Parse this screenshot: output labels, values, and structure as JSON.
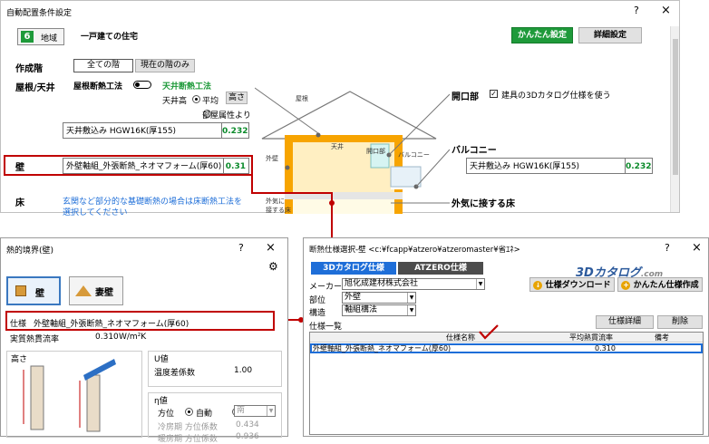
{
  "main": {
    "title": "自動配置条件設定",
    "help": "?",
    "close": "×",
    "region_number": "6",
    "region_label": "地域",
    "house_type": "一戸建ての住宅",
    "easy_button": "かんたん設定",
    "detail_button": "詳細設定",
    "floor_label": "作成階",
    "all_floors": "全ての階",
    "current_floor": "現在の階のみ",
    "roof_ceiling": "屋根/天井",
    "roof_insulation": "屋根断熱工法",
    "ceiling_insulation": "天井断熱工法",
    "ceiling_height": "天井高",
    "average": "平均",
    "height_btn": "高さ",
    "room_attr": "部屋属性より",
    "ceiling_spec": "天井敷込み HGW16K(厚155)",
    "ceiling_value": "0.232",
    "wall_label": "壁",
    "wall_spec": "外壁軸組_外張断熱_ネオマフォーム(厚60)",
    "wall_value": "0.31",
    "floor_section": "床",
    "floor_note": "玄関など部分的な基礎断熱の場合は床断熱工法を",
    "floor_note2": "選択してください",
    "opening": "開口部",
    "catalog_check": "建具の3Dカタログ仕様を使う",
    "balcony": "バルコニー",
    "balcony_spec": "天井敷込み HGW16K(厚155)",
    "balcony_value": "0.232",
    "outside_floor": "外気に接する床",
    "diagram": {
      "roof": "屋根",
      "ceiling": "天井",
      "opening": "開口部",
      "outer_wall": "外壁",
      "balcony": "バルコニー",
      "outside_a": "外気に",
      "outside_b": "接する床"
    }
  },
  "thermal": {
    "title": "熱的境界(壁)",
    "help": "?",
    "close": "×",
    "wall_tab": "壁",
    "gable_tab": "妻壁",
    "spec_label": "仕様",
    "spec_value": "外壁軸組_外張断熱_ネオマフォーム(厚60)",
    "heat_rate_label": "実質熱貫流率",
    "heat_rate_value": "0.310",
    "heat_rate_unit": "W/m²K",
    "height_label": "高さ",
    "u_value": "U値",
    "temp_coef": "温度差係数",
    "temp_coef_value": "1.00",
    "eta_value": "η値",
    "direction": "方位",
    "auto": "自動",
    "south": "南",
    "cooling": "冷房期 方位係数",
    "cooling_value": "0.434",
    "heating": "暖房期 方位係数",
    "heating_value": "0.936"
  },
  "spec": {
    "title": "断熱仕様選択-壁 <c:¥fcapp¥atzero¥atzeromaster¥省ｴﾈ>",
    "help": "?",
    "close": "×",
    "tab_catalog": "3Dカタログ仕様",
    "tab_atzero": "ATZERO仕様",
    "logo": "3Dカタログ",
    "logo_suffix": ".com",
    "maker_label": "メーカー",
    "maker_value": "旭化成建材株式会社",
    "part_label": "部位",
    "part_value": "外壁",
    "structure_label": "構造",
    "structure_value": "軸組構法",
    "download_btn": "仕様ダウンロード",
    "easy_create_btn": "かんたん仕様作成",
    "list_label": "仕様一覧",
    "detail_btn": "仕様詳細",
    "delete_btn": "削除",
    "col_name": "仕様名称",
    "col_rate": "平均熱貫流率",
    "col_note": "備考",
    "rows": [
      {
        "name": "外壁軸組_外張断熱_ネオマフォーム(厚60)",
        "rate": "0.310",
        "note": ""
      }
    ]
  },
  "colors": {
    "green": "#1e9a3a",
    "red": "#c00000",
    "orange": "#f7a400",
    "blue": "#1e6ed8"
  }
}
